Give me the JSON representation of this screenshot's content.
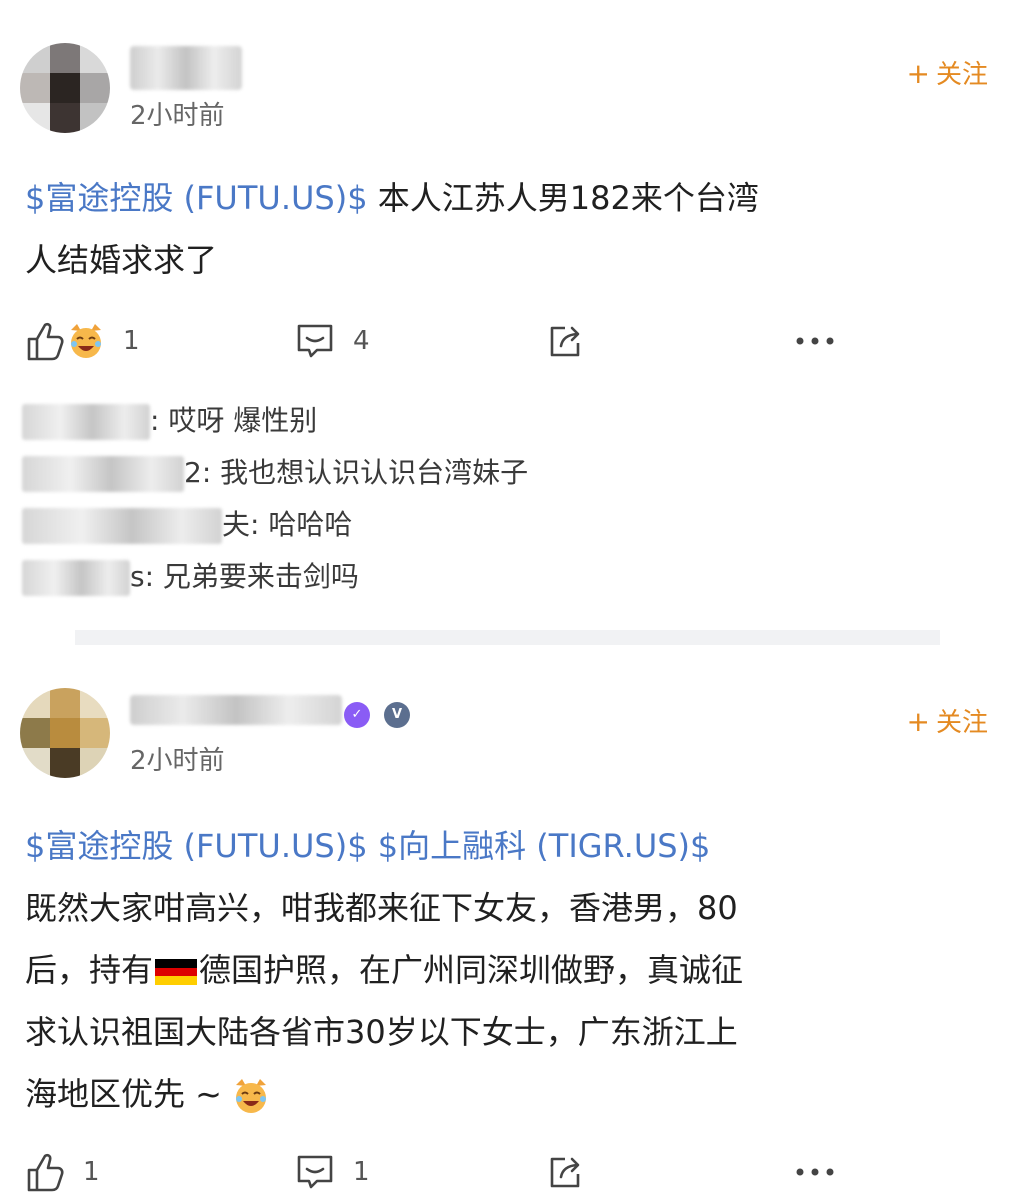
{
  "posts": [
    {
      "timestamp": "2小时前",
      "follow_label": "关注",
      "follow_plus": "+",
      "stock_tag": "$富途控股 (FUTU.US)$",
      "body_line1": " 本人江苏人男182来个台湾",
      "body_line2": "人结婚求求了",
      "like_count": "1",
      "comment_count": "4",
      "comments": [
        {
          "name_tail": "",
          "text": ": 哎呀 爆性别"
        },
        {
          "name_tail": "2",
          "text": ": 我也想认识认识台湾妹子"
        },
        {
          "name_tail": "夫",
          "text": ": 哈哈哈"
        },
        {
          "name_tail": "s",
          "text": ": 兄弟要来击剑吗"
        }
      ]
    },
    {
      "timestamp": "2小时前",
      "follow_label": "关注",
      "follow_plus": "+",
      "badge_v": "V",
      "stock_tag_1": "$富途控股 (FUTU.US)$",
      "stock_tag_2": "$向上融科 (TIGR.US)$",
      "body_line1": "既然大家咁高兴，咁我都来征下女友，香港男，80",
      "body_line2a": "后，持有",
      "body_line2b": "德国护照，在广州同深圳做野，真诚征",
      "body_line3": "求认识祖国大陆各省市30岁以下女士，广东浙江上",
      "body_line4": "海地区优先 ~",
      "like_count": "1",
      "comment_count": "1"
    }
  ],
  "colors": {
    "stock_link": "#4a78c6",
    "follow_orange": "#e48a22",
    "flag_black": "#000000",
    "flag_red": "#dd0000",
    "flag_gold": "#ffce00"
  },
  "icons": {
    "like": "thumbs-up-icon",
    "comment": "comment-bubble-icon",
    "share": "share-icon",
    "more": "more-dots-icon",
    "emoji": "laughing-cat-emoji-icon",
    "flag": "germany-flag-icon"
  }
}
